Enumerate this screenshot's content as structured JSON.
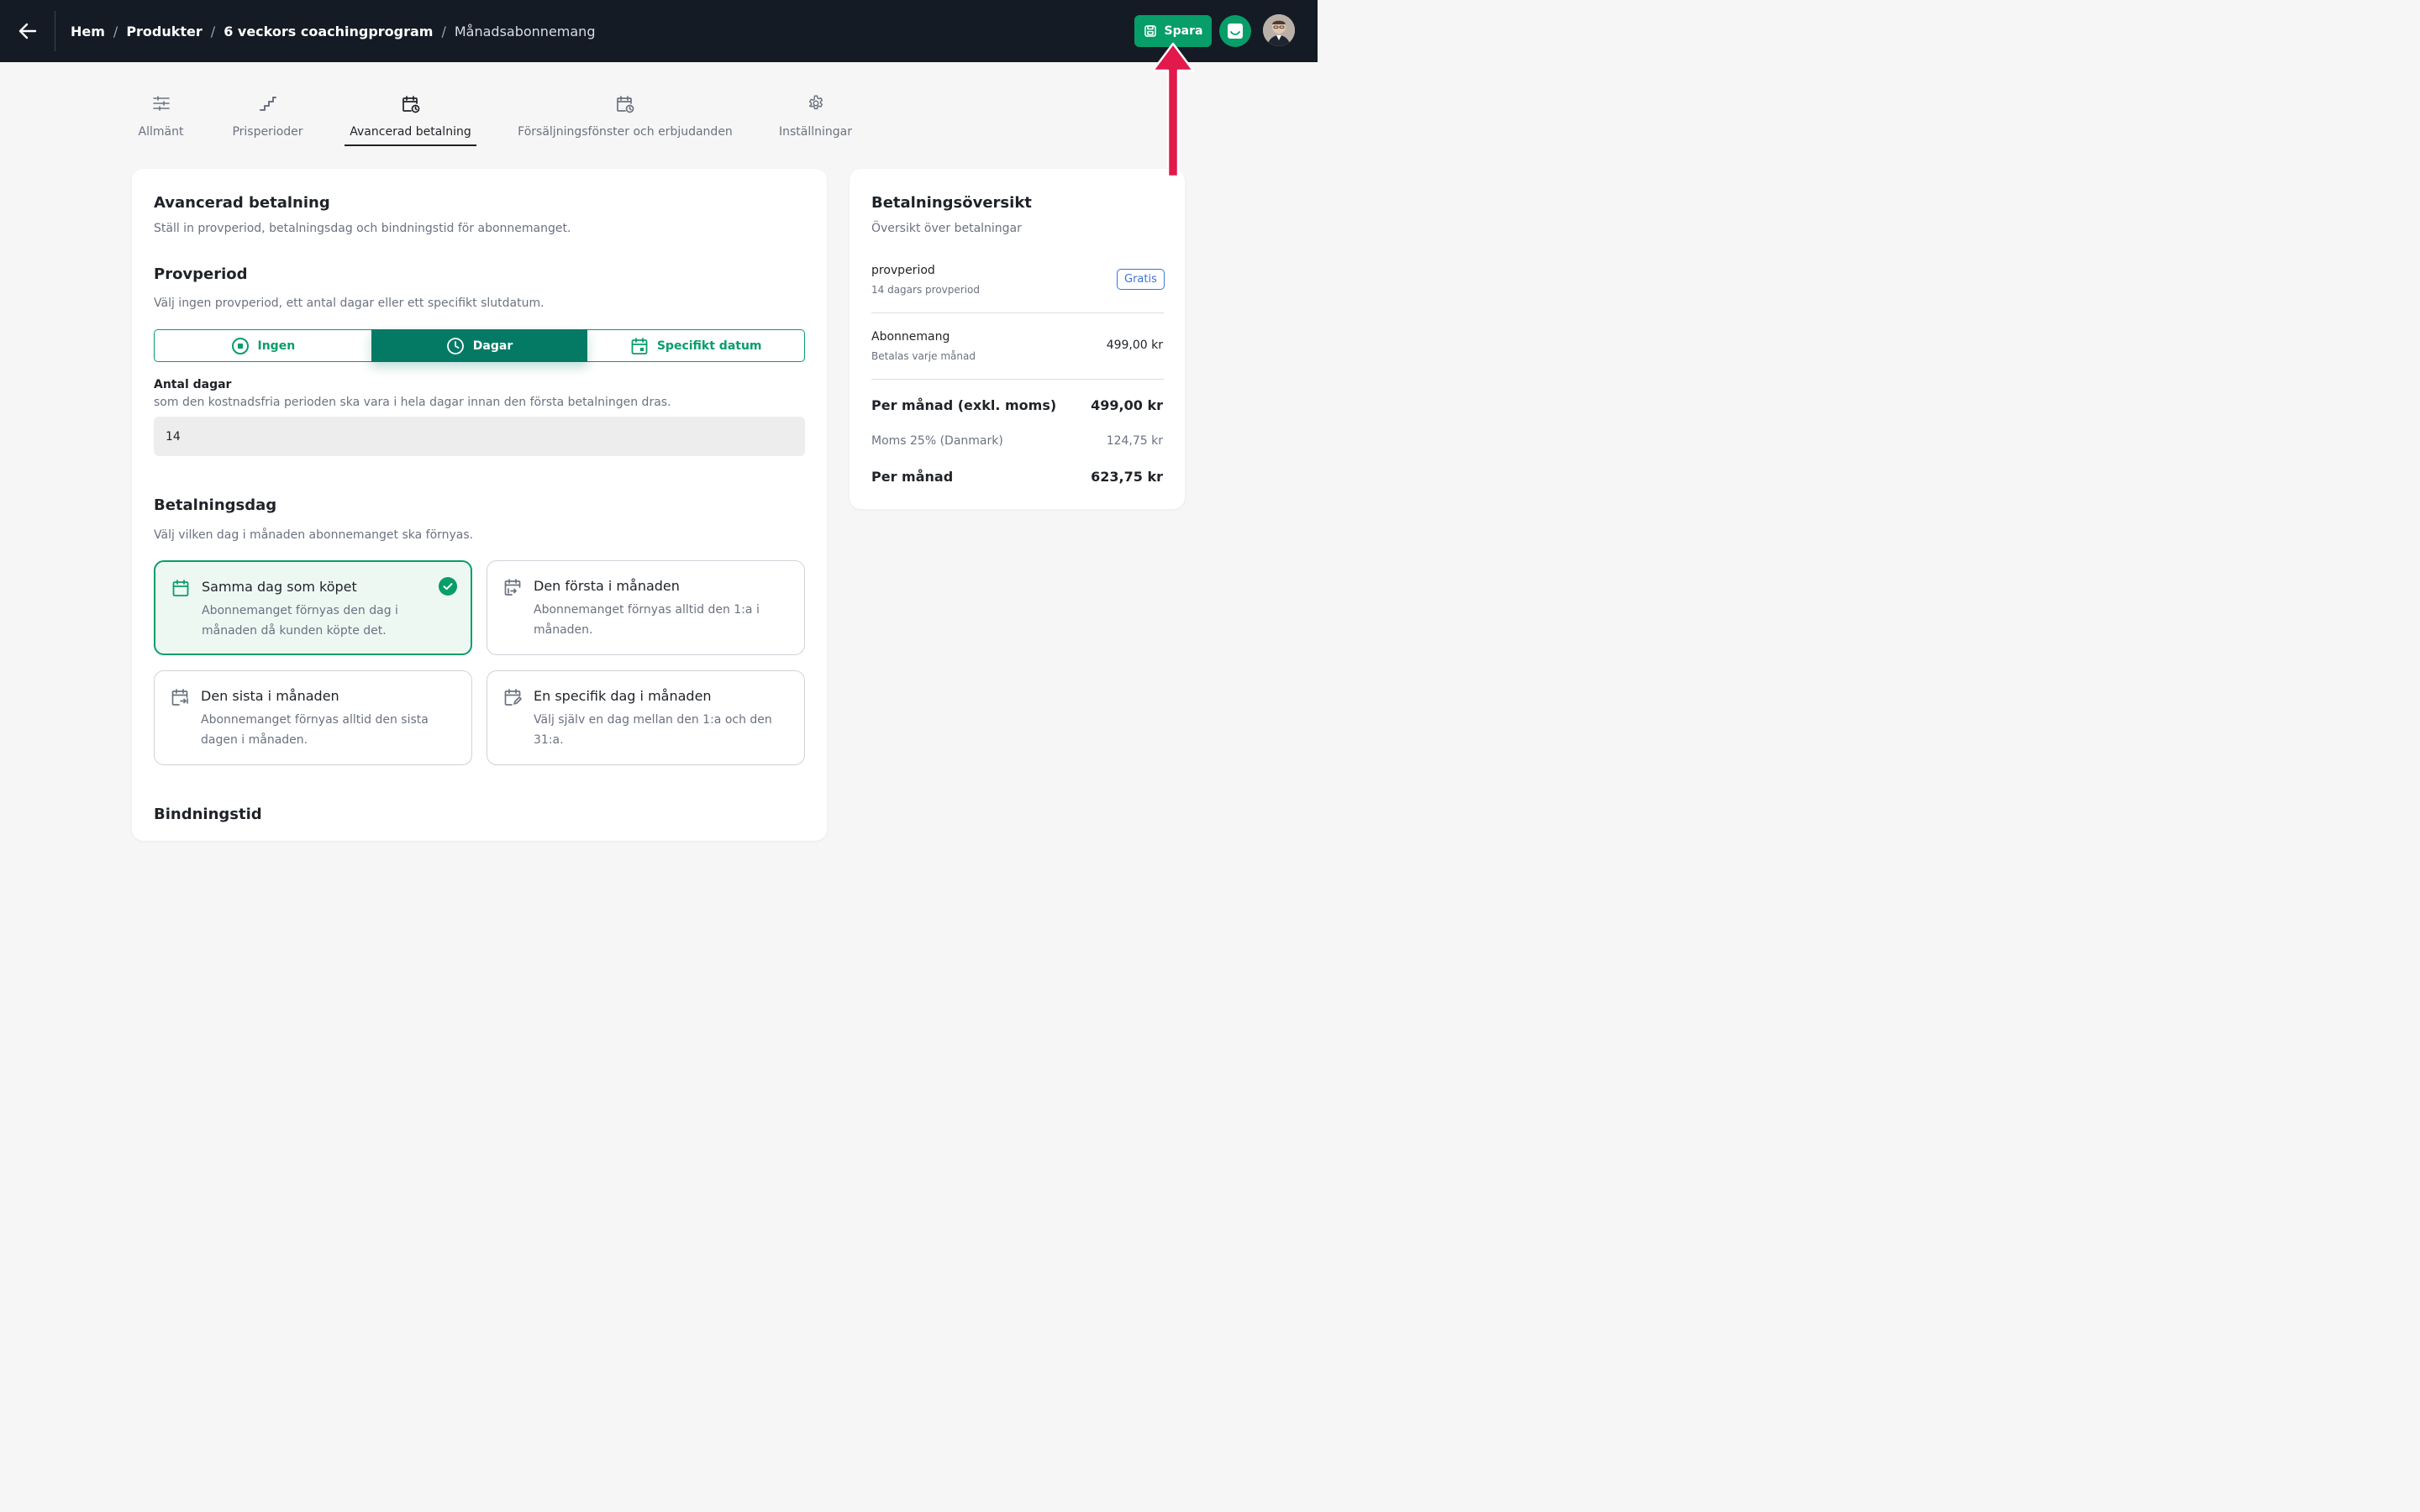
{
  "header": {
    "breadcrumb": [
      "Hem",
      "Produkter",
      "6 veckors coachingprogram"
    ],
    "current": "Månadsabonnemang",
    "save_label": "Spara"
  },
  "tabs": [
    {
      "label": "Allmänt",
      "icon": "sliders-icon"
    },
    {
      "label": "Prisperioder",
      "icon": "steps-icon"
    },
    {
      "label": "Avancerad betalning",
      "icon": "calendar-clock-icon",
      "active": true
    },
    {
      "label": "Försäljningsfönster och erbjudanden",
      "icon": "calendar-clock-icon"
    },
    {
      "label": "Inställningar",
      "icon": "gear-icon"
    }
  ],
  "main": {
    "title": "Avancerad betalning",
    "subtitle": "Ställ in provperiod, betalningsdag och bindningstid för abonnemanget.",
    "trial": {
      "title": "Provperiod",
      "subtitle": "Välj ingen provperiod, ett antal dagar eller ett specifikt slutdatum.",
      "options": [
        "Ingen",
        "Dagar",
        "Specifikt datum"
      ],
      "selected": "Dagar",
      "days_label": "Antal dagar",
      "days_help": "som den kostnadsfria perioden ska vara i hela dagar innan den första betalningen dras.",
      "days_value": "14"
    },
    "payday": {
      "title": "Betalningsdag",
      "subtitle": "Välj vilken dag i månaden abonnemanget ska förnyas.",
      "options": [
        {
          "title": "Samma dag som köpet",
          "desc": "Abonnemanget förnyas den dag i månaden då kunden köpte det.",
          "selected": true
        },
        {
          "title": "Den första i månaden",
          "desc": "Abonnemanget förnyas alltid den 1:a i månaden."
        },
        {
          "title": "Den sista i månaden",
          "desc": "Abonnemanget förnyas alltid den sista dagen i månaden."
        },
        {
          "title": "En specifik dag i månaden",
          "desc": "Välj själv en dag mellan den 1:a och den 31:a."
        }
      ]
    },
    "binding_title": "Bindningstid"
  },
  "overview": {
    "title": "Betalningsöversikt",
    "subtitle": "Översikt över betalningar",
    "trial_title": "provperiod",
    "trial_sub": "14 dagars provperiod",
    "trial_badge": "Gratis",
    "sub_title": "Abonnemang",
    "sub_sub": "Betalas varje månad",
    "sub_value": "499,00 kr",
    "excl_label": "Per månad (exkl. moms)",
    "excl_value": "499,00 kr",
    "vat_label": "Moms 25% (Danmark)",
    "vat_value": "124,75 kr",
    "total_label": "Per månad",
    "total_value": "623,75 kr"
  },
  "colors": {
    "accent": "#079e69",
    "accent_dark": "#047a65",
    "topbar": "#141b25",
    "arrow": "#e3194b",
    "badge": "#3b73d8"
  }
}
